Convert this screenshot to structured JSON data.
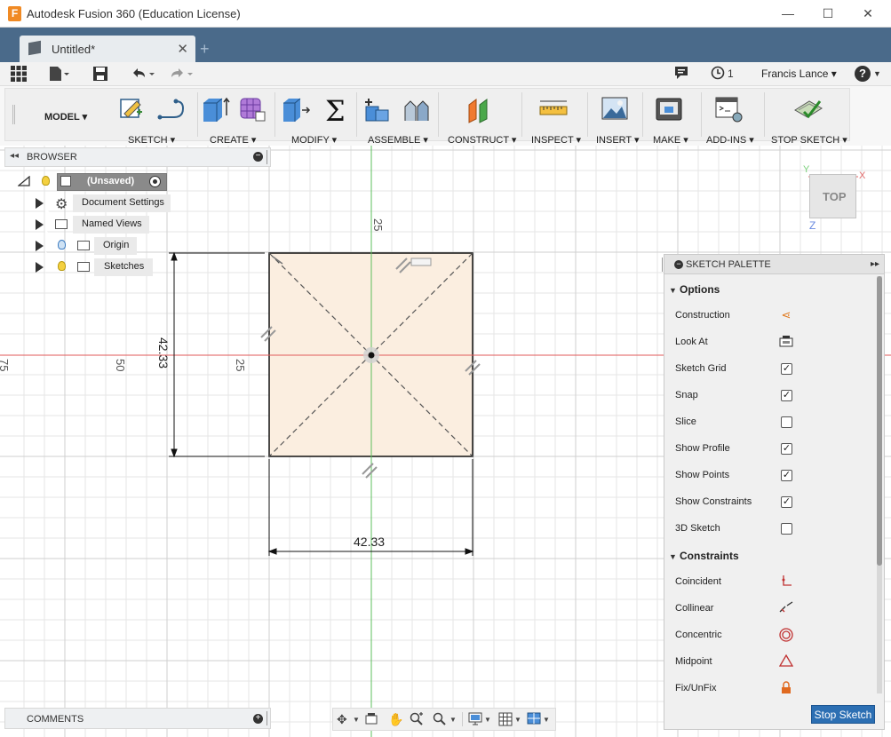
{
  "window": {
    "title": "Autodesk Fusion 360 (Education License)",
    "logo_letter": "F"
  },
  "tabs": {
    "document_title": "Untitled*",
    "close_glyph": "✕",
    "new_tab_glyph": "+"
  },
  "quick_access": {
    "job_count": "1",
    "user_name": "Francis Lance ▾",
    "help": "?"
  },
  "toolbar": {
    "workspace": "MODEL ▾",
    "groups": {
      "sketch": "SKETCH ▾",
      "create": "CREATE ▾",
      "modify": "MODIFY ▾",
      "assemble": "ASSEMBLE ▾",
      "construct": "CONSTRUCT ▾",
      "inspect": "INSPECT ▾",
      "insert": "INSERT ▾",
      "make": "MAKE ▾",
      "addins": "ADD-INS ▾",
      "stop_sketch": "STOP SKETCH ▾"
    }
  },
  "browser": {
    "title": "BROWSER",
    "root": "(Unsaved)",
    "items": [
      {
        "label": "Document Settings"
      },
      {
        "label": "Named Views"
      },
      {
        "label": "Origin"
      },
      {
        "label": "Sketches"
      }
    ]
  },
  "comments": {
    "title": "COMMENTS"
  },
  "canvas": {
    "axis_labels": {
      "top": "25",
      "left_50": "50",
      "left_25": "25",
      "left_75": "75"
    },
    "dimensions": {
      "vertical": "42.33",
      "horizontal": "42.33"
    }
  },
  "viewcube": {
    "face": "TOP",
    "axis_x": "X",
    "axis_y": "Y",
    "axis_z": "Z"
  },
  "palette": {
    "title": "SKETCH PALETTE",
    "options_header": "Options",
    "options": [
      {
        "label": "Construction",
        "type": "icon",
        "icon": "construction-icon"
      },
      {
        "label": "Look At",
        "type": "icon",
        "icon": "look-at-icon"
      },
      {
        "label": "Sketch Grid",
        "type": "checkbox",
        "checked": true
      },
      {
        "label": "Snap",
        "type": "checkbox",
        "checked": true
      },
      {
        "label": "Slice",
        "type": "checkbox",
        "checked": false
      },
      {
        "label": "Show Profile",
        "type": "checkbox",
        "checked": true
      },
      {
        "label": "Show Points",
        "type": "checkbox",
        "checked": true
      },
      {
        "label": "Show Constraints",
        "type": "checkbox",
        "checked": true
      },
      {
        "label": "3D Sketch",
        "type": "checkbox",
        "checked": false
      }
    ],
    "constraints_header": "Constraints",
    "constraints": [
      {
        "label": "Coincident",
        "icon": "coincident-icon"
      },
      {
        "label": "Collinear",
        "icon": "collinear-icon"
      },
      {
        "label": "Concentric",
        "icon": "concentric-icon"
      },
      {
        "label": "Midpoint",
        "icon": "midpoint-icon"
      },
      {
        "label": "Fix/UnFix",
        "icon": "lock-icon"
      }
    ],
    "stop_button": "Stop Sketch"
  },
  "colors": {
    "tabbar": "#4a6a8a",
    "profile_fill": "#fbeee0",
    "x_axis": "#e05a5a",
    "y_axis": "#4caf50",
    "primary_button": "#2c6fb3"
  }
}
